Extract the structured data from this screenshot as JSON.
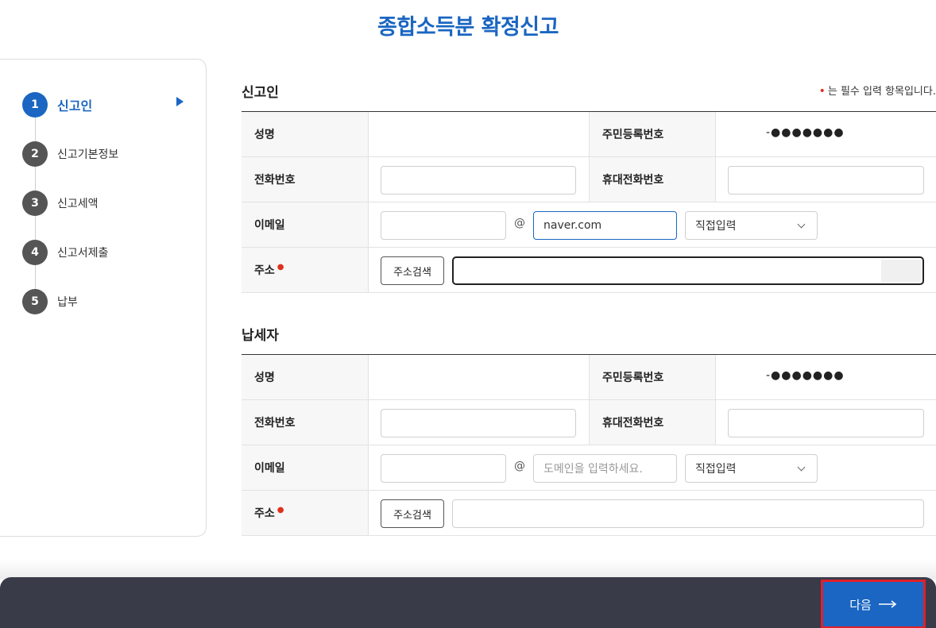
{
  "page": {
    "title": "종합소득분 확정신고"
  },
  "stepper": {
    "items": [
      {
        "num": "1",
        "label": "신고인"
      },
      {
        "num": "2",
        "label": "신고기본정보"
      },
      {
        "num": "3",
        "label": "신고세액"
      },
      {
        "num": "4",
        "label": "신고서제출"
      },
      {
        "num": "5",
        "label": "납부"
      }
    ],
    "active_index": 0
  },
  "required_note": "는 필수 입력 항목입니다.",
  "reporter": {
    "title": "신고인",
    "name_label": "성명",
    "name_value": "",
    "rrn_label": "주민등록번호",
    "rrn_value": "-●●●●●●●",
    "phone_label": "전화번호",
    "phone_value": "",
    "mobile_label": "휴대전화번호",
    "mobile_value": "",
    "email_label": "이메일",
    "email_id": "",
    "email_at": "@",
    "email_domain": "naver.com",
    "email_select": "직접입력",
    "address_label": "주소",
    "address_search": "주소검색",
    "address_value": ""
  },
  "taxpayer": {
    "title": "납세자",
    "name_label": "성명",
    "name_value": "",
    "rrn_label": "주민등록번호",
    "rrn_value": "-●●●●●●●",
    "phone_label": "전화번호",
    "phone_value": "",
    "mobile_label": "휴대전화번호",
    "mobile_value": "",
    "email_label": "이메일",
    "email_id": "",
    "email_at": "@",
    "email_domain_placeholder": "도메인을 입력하세요.",
    "email_select": "직접입력",
    "address_label": "주소",
    "address_search": "주소검색",
    "address_value": ""
  },
  "footer": {
    "next_label": "다음"
  },
  "colors": {
    "accent": "#1a66c2",
    "required": "#e0301e",
    "footer": "#393b49",
    "highlight": "#e0202a"
  }
}
